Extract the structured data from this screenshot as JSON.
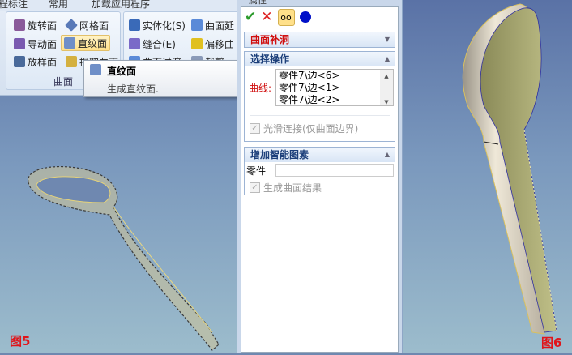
{
  "ribbon": {
    "tabs": [
      "程标注",
      "常用",
      "加载应用程序"
    ],
    "buttons": [
      {
        "label": "旋转面",
        "icon": "revolve-surface-icon"
      },
      {
        "label": "网格面",
        "icon": "mesh-surface-icon"
      },
      {
        "label": "导动面",
        "icon": "sweep-surface-icon"
      },
      {
        "label": "直纹面",
        "icon": "ruled-surface-icon"
      },
      {
        "label": "放样面",
        "icon": "loft-surface-icon"
      },
      {
        "label": "提取曲面",
        "icon": "extract-surface-icon"
      },
      {
        "label": "实体化(S)",
        "icon": "solidify-icon"
      },
      {
        "label": "曲面延",
        "icon": "extend-surface-icon"
      },
      {
        "label": "缝合(E)",
        "icon": "stitch-icon"
      },
      {
        "label": "偏移曲",
        "icon": "offset-surface-icon"
      },
      {
        "label": "曲面过渡",
        "icon": "surface-blend-icon"
      },
      {
        "label": "裁剪",
        "icon": "trim-icon"
      }
    ],
    "group_label": "曲面"
  },
  "tooltip": {
    "title": "直纹面",
    "desc": "生成直纹面."
  },
  "panel": {
    "title": "属性",
    "section1": {
      "title": "曲面补洞"
    },
    "section2": {
      "title": "选择操作",
      "curve_label": "曲线:",
      "curves": [
        "零件7\\边<6>",
        "零件7\\边<1>",
        "零件7\\边<2>"
      ],
      "smooth_label": "光滑连接(仅曲面边界)",
      "smooth_checked": true
    },
    "section3": {
      "title": "增加智能图素",
      "part_label": "零件",
      "part_value": "",
      "result_label": "生成曲面结果",
      "result_checked": true
    }
  },
  "figures": {
    "left": "图5",
    "right": "图6"
  },
  "colors": {
    "accent_red": "#e0151a",
    "header_blue": "#1c3f7a"
  }
}
